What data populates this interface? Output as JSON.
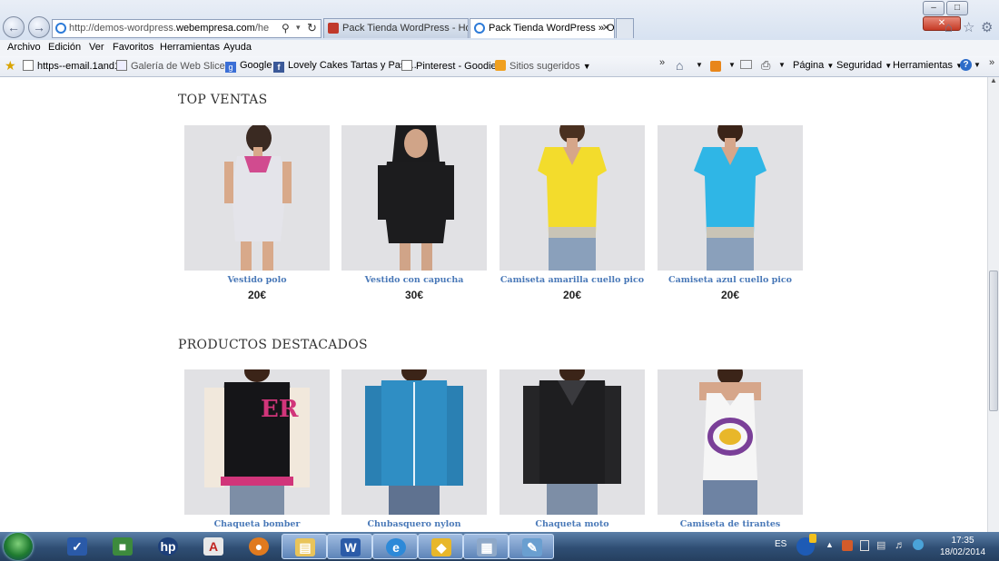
{
  "browser": {
    "url_prefix": "http://demos-wordpress.",
    "url_domain": "webempresa.com",
    "url_path": "/helena/",
    "tabs": [
      {
        "label": "Pack Tienda WordPress - Hosti...",
        "active": false
      },
      {
        "label": "Pack Tienda WordPress » O...",
        "active": true
      }
    ]
  },
  "menu": [
    "Archivo",
    "Edición",
    "Ver",
    "Favoritos",
    "Herramientas",
    "Ayuda"
  ],
  "favorites": [
    {
      "label": "https--email.1and1",
      "icon": "page-icon"
    },
    {
      "label": "Galería de Web Slice",
      "icon": "webslice-icon",
      "dropdown": true
    },
    {
      "label": "Google",
      "icon": "google-icon"
    },
    {
      "label": "Lovely Cakes Tartas y Past...",
      "icon": "facebook-icon"
    },
    {
      "label": "Pinterest - Goodies",
      "icon": "page-icon"
    },
    {
      "label": "Sitios sugeridos",
      "icon": "suggested-icon",
      "dropdown": true
    }
  ],
  "commandbar": {
    "page": "Página",
    "safety": "Seguridad",
    "tools": "Herramientas"
  },
  "sections": [
    {
      "title": "TOP VENTAS",
      "products": [
        {
          "name": "Vestido polo",
          "price": "20€"
        },
        {
          "name": "Vestido con capucha",
          "price": "30€"
        },
        {
          "name": "Camiseta amarilla cuello pico",
          "price": "20€"
        },
        {
          "name": "Camiseta azul cuello pico",
          "price": "20€"
        }
      ]
    },
    {
      "title": "PRODUCTOS DESTACADOS",
      "products": [
        {
          "name": "Chaqueta bomber"
        },
        {
          "name": "Chubasquero nylon"
        },
        {
          "name": "Chaqueta moto"
        },
        {
          "name": "Camiseta de tirantes"
        }
      ]
    }
  ],
  "taskbar": {
    "language": "ES",
    "time": "17:35",
    "date": "18/02/2014"
  },
  "colors": {
    "link": "#4a79b8",
    "section_title": "#333333"
  }
}
